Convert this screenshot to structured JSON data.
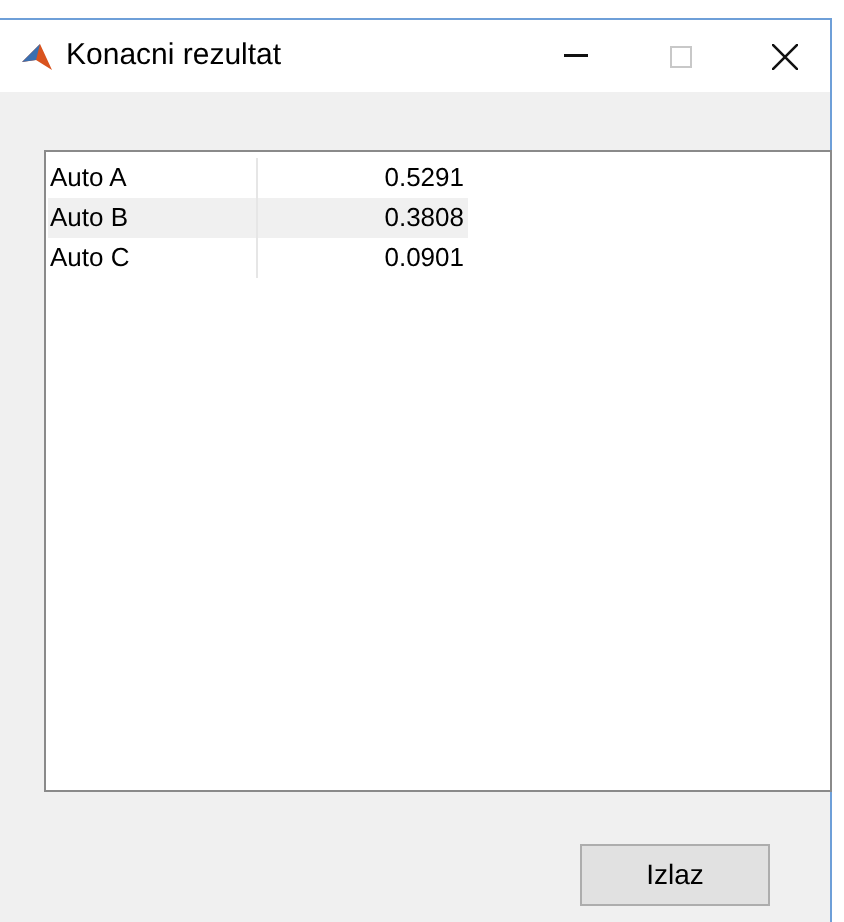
{
  "window": {
    "title": "Konacni rezultat"
  },
  "table": {
    "rows": [
      {
        "cells": [
          "Auto A",
          "0.5291"
        ]
      },
      {
        "cells": [
          "Auto B",
          "0.3808"
        ]
      },
      {
        "cells": [
          "Auto C",
          "0.0901"
        ]
      }
    ]
  },
  "buttons": [
    "Izlaz"
  ]
}
